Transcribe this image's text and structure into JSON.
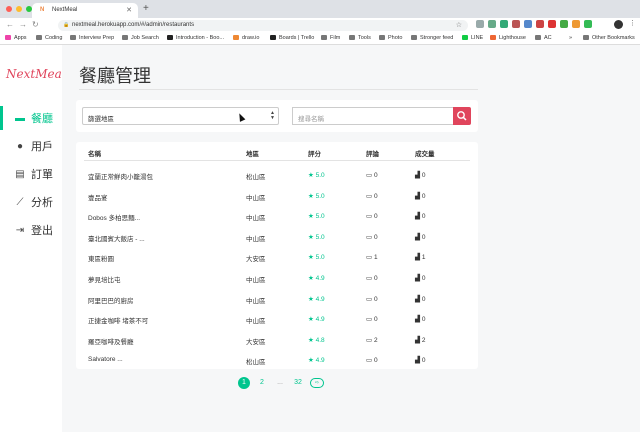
{
  "browser": {
    "tab_title": "NextMeal",
    "tab_favicon": "N",
    "url": "nextmeal.herokuapp.com/#/admin/restaurants",
    "bookmarks": [
      "Apps",
      "Coding",
      "Interview Prep",
      "Job Search",
      "Introduction - Boo...",
      "draw.io",
      "Boards | Trello",
      "Film",
      "Tools",
      "Photo",
      "Stronger feed",
      "LINE",
      "Lighthouse",
      "AC",
      "Other Bookmarks"
    ],
    "bookmarks_overflow": "»"
  },
  "sidebar": {
    "logo": "NextMeal",
    "items": [
      {
        "label": "餐廳",
        "icon": "store-icon"
      },
      {
        "label": "用戶",
        "icon": "user-icon"
      },
      {
        "label": "訂單",
        "icon": "clipboard-icon"
      },
      {
        "label": "分析",
        "icon": "line-chart-icon"
      },
      {
        "label": "登出",
        "icon": "logout-icon"
      }
    ],
    "active_index": 0
  },
  "page": {
    "title": "餐廳管理"
  },
  "filter": {
    "district_select": "篩選地區",
    "search_placeholder": "搜尋名稱"
  },
  "table": {
    "headers": [
      "名稱",
      "地區",
      "評分",
      "評論",
      "成交量"
    ],
    "rows": [
      {
        "name": "宜蘭正常鮮肉小籠湯包",
        "district": "松山區",
        "rating": "5.0",
        "reviews": "0",
        "orders": "0"
      },
      {
        "name": "壹品宴",
        "district": "中山區",
        "rating": "5.0",
        "reviews": "0",
        "orders": "0"
      },
      {
        "name": "Dobos 多柏思麵...",
        "district": "中山區",
        "rating": "5.0",
        "reviews": "0",
        "orders": "0"
      },
      {
        "name": "臺北國賓大飯店 - ...",
        "district": "中山區",
        "rating": "5.0",
        "reviews": "0",
        "orders": "0"
      },
      {
        "name": "東區粉圓",
        "district": "大安區",
        "rating": "5.0",
        "reviews": "1",
        "orders": "1"
      },
      {
        "name": "夢見培比屯",
        "district": "中山區",
        "rating": "4.9",
        "reviews": "0",
        "orders": "0"
      },
      {
        "name": "阿里巴巴的廚房",
        "district": "中山區",
        "rating": "4.9",
        "reviews": "0",
        "orders": "0"
      },
      {
        "name": "正捷金咖啡 堵茶不可",
        "district": "中山區",
        "rating": "4.9",
        "reviews": "0",
        "orders": "0"
      },
      {
        "name": "羅亞咖啡及餐廳",
        "district": "大安區",
        "rating": "4.8",
        "reviews": "2",
        "orders": "2"
      },
      {
        "name": "Salvatore ...",
        "district": "松山區",
        "rating": "4.9",
        "reviews": "0",
        "orders": "0"
      }
    ]
  },
  "pagination": {
    "pages": [
      "1",
      "2",
      "...",
      "32"
    ],
    "current": "1",
    "next": "⇨"
  },
  "colors": {
    "accent": "#00c58e",
    "brand": "#e0455c"
  }
}
